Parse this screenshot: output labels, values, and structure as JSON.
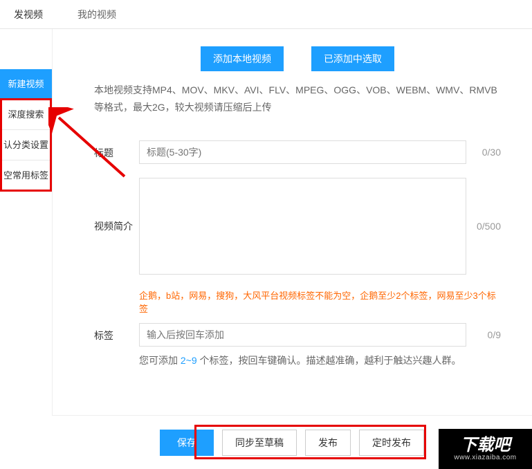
{
  "tabs": {
    "publish": "发视频",
    "mine": "我的视频"
  },
  "sidebar": {
    "items": [
      {
        "label": "新建视频"
      },
      {
        "label": "深度搜索"
      },
      {
        "label": "认分类设置"
      },
      {
        "label": "空常用标签"
      }
    ]
  },
  "upload": {
    "add_local": "添加本地视频",
    "select_added": "已添加中选取",
    "hint": "本地视频支持MP4、MOV、MKV、AVI、FLV、MPEG、OGG、VOB、WEBM、WMV、RMVB等格式，最大2G，较大视频请压缩后上传"
  },
  "form": {
    "title_label": "标题",
    "title_placeholder": "标题(5-30字)",
    "title_counter": "0/30",
    "intro_label": "视频简介",
    "intro_counter": "0/500",
    "tag_warning": "企鹅，b站，网易，搜狗，大风平台视频标签不能为空，企鹅至少2个标签，网易至少3个标签",
    "tag_label": "标签",
    "tag_placeholder": "输入后按回车添加",
    "tag_counter": "0/9",
    "tag_help_prefix": "您可添加 ",
    "tag_help_range": "2~9",
    "tag_help_suffix": " 个标签，按回车键确认。描述越准确，越利于触达兴趣人群。"
  },
  "footer": {
    "save": "保存",
    "sync_draft": "同步至草稿",
    "publish": "发布",
    "schedule": "定时发布"
  },
  "watermark": {
    "main": "下载吧",
    "sub": "www.xiazaiba.com"
  }
}
